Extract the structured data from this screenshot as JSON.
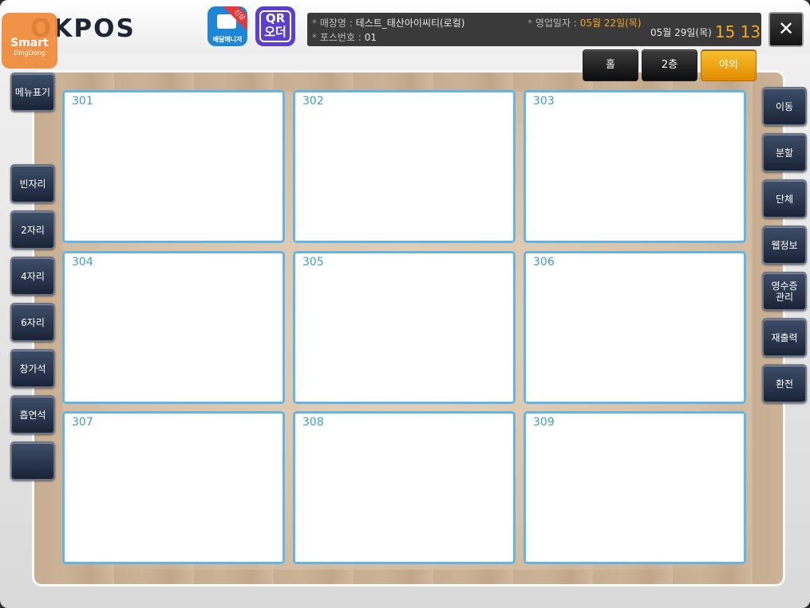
{
  "header": {
    "logo_text": "OKPOS",
    "smart_badge": {
      "line1": "Smart",
      "line2": "DingDong"
    },
    "delivery_icon": {
      "label": "배달매니저",
      "ribbon": "신상"
    },
    "qr_icon": {
      "line1": "QR",
      "line2": "오더"
    },
    "store_label": "매장명 :",
    "store_name": "테스트_태산아이씨티(로컬)",
    "pos_label": "포스번호 :",
    "pos_number": "01",
    "bizdate_label": "영업일자 :",
    "bizdate_value": "05월 22일(목)",
    "current_date": "05월 29일(목)",
    "current_time": "15 13",
    "close_symbol": "✕"
  },
  "floor_tabs": [
    {
      "label": "홀",
      "active": false
    },
    {
      "label": "2층",
      "active": false
    },
    {
      "label": "야외",
      "active": true
    }
  ],
  "left_buttons": [
    {
      "label": "메뉴표기"
    },
    {
      "label": "빈자리"
    },
    {
      "label": "2자리"
    },
    {
      "label": "4자리"
    },
    {
      "label": "6자리"
    },
    {
      "label": "창가석"
    },
    {
      "label": "흡연석"
    },
    {
      "label": ""
    }
  ],
  "tables": [
    {
      "number": "301"
    },
    {
      "number": "302"
    },
    {
      "number": "303"
    },
    {
      "number": "304"
    },
    {
      "number": "305"
    },
    {
      "number": "306"
    },
    {
      "number": "307"
    },
    {
      "number": "308"
    },
    {
      "number": "309"
    }
  ],
  "right_buttons": [
    {
      "label": "이동"
    },
    {
      "label": "분할"
    },
    {
      "label": "단체"
    },
    {
      "label": "웹정보"
    },
    {
      "label": "영수증\n관리"
    },
    {
      "label": "재출력"
    },
    {
      "label": "환전"
    }
  ],
  "colors": {
    "accent_orange": "#f5a524",
    "table_border": "#62b6e6",
    "side_button": "#2a3650"
  }
}
